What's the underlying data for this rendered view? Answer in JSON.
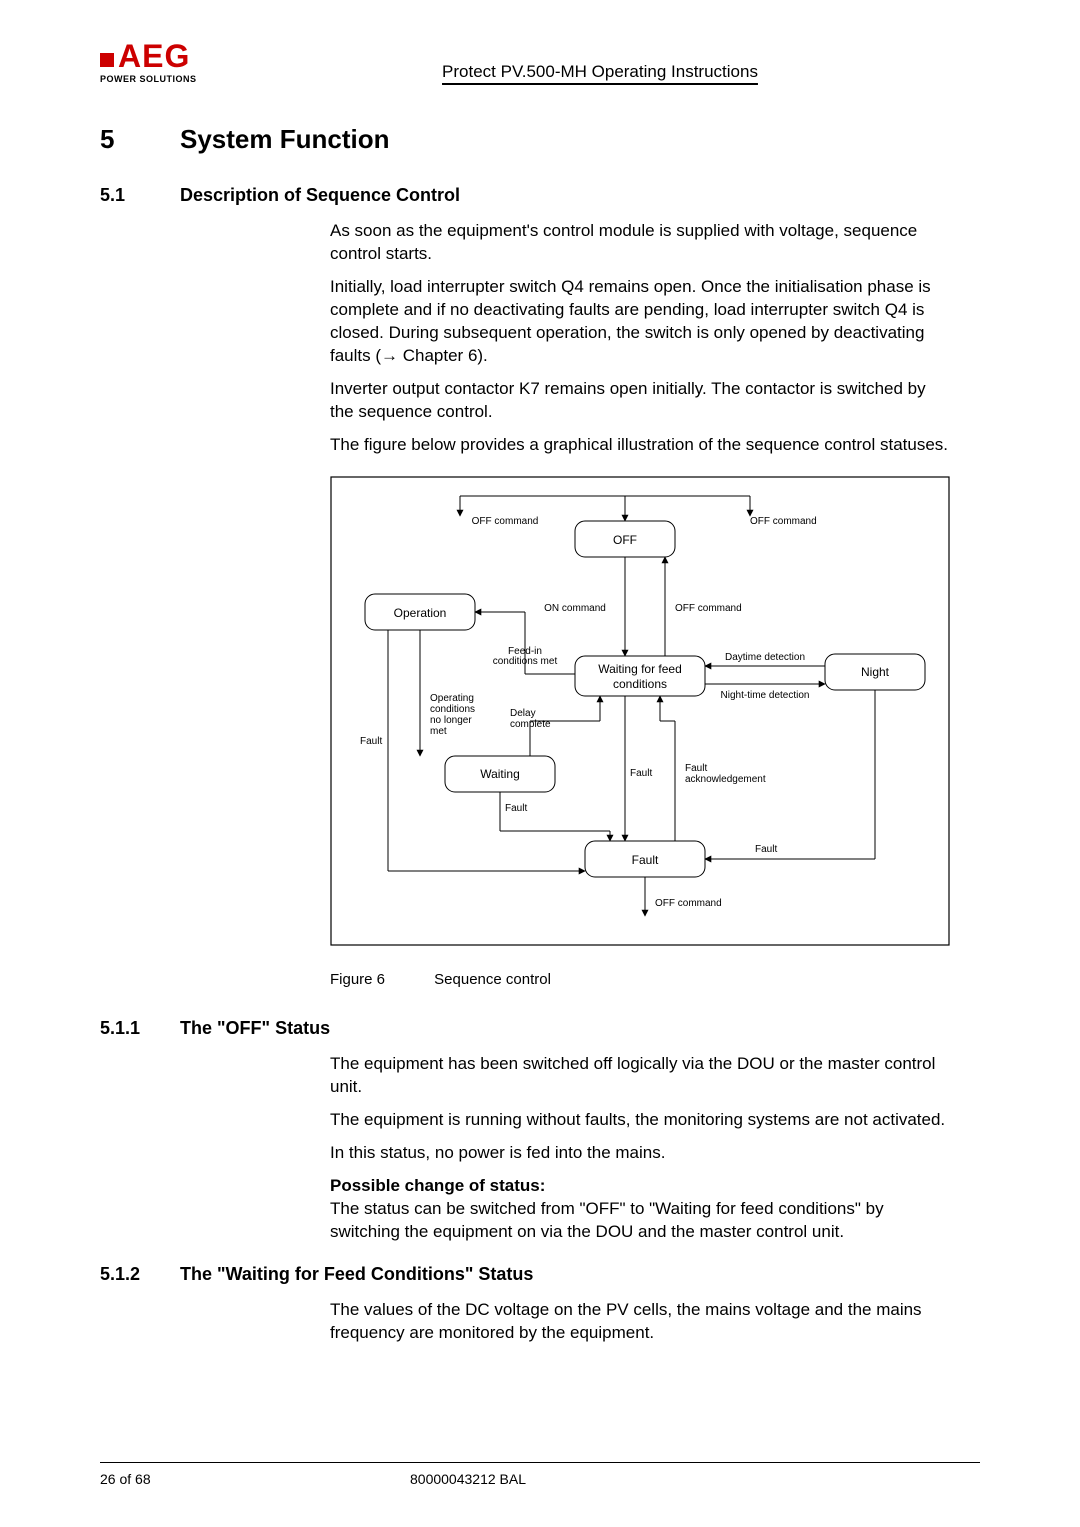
{
  "header": {
    "doc_title": "Protect PV.500-MH Operating Instructions",
    "logo_text": "AEG",
    "logo_sub": "POWER SOLUTIONS"
  },
  "section": {
    "num": "5",
    "title": "System Function"
  },
  "s51": {
    "num": "5.1",
    "title": "Description of Sequence Control",
    "p1": "As soon as the equipment's control module is supplied with voltage, sequence control starts.",
    "p2": "Initially, load interrupter switch Q4 remains open. Once the initialisation phase is complete and if no deactivating faults are pending, load interrupter switch Q4 is closed. During subsequent operation, the switch is only opened by deactivating faults (→ Chapter 6).",
    "p3": "Inverter output contactor K7 remains open initially. The contactor is switched by the sequence control.",
    "p4": "The figure below provides a graphical illustration of the sequence control statuses."
  },
  "figure": {
    "label": "Figure 6",
    "caption": "Sequence control",
    "nodes": {
      "off": "OFF",
      "operation": "Operation",
      "waiting_feed_l1": "Waiting for feed",
      "waiting_feed_l2": "conditions",
      "night": "Night",
      "waiting": "Waiting",
      "fault": "Fault"
    },
    "edges": {
      "off_cmd": "OFF command",
      "on_cmd": "ON command",
      "feed_cond_l1": "Feed-in",
      "feed_cond_l2": "conditions met",
      "daytime": "Daytime detection",
      "nighttime": "Night-time detection",
      "op_cond_l1": "Operating",
      "op_cond_l2": "conditions",
      "op_cond_l3": "no longer",
      "op_cond_l4": "met",
      "delay_l1": "Delay",
      "delay_l2": "complete",
      "fault_lbl": "Fault",
      "fault_ack_l1": "Fault",
      "fault_ack_l2": "acknowledgement"
    }
  },
  "s511": {
    "num": "5.1.1",
    "title": "The \"OFF\" Status",
    "p1": "The equipment has been switched off logically via the DOU or the master control unit.",
    "p2": "The equipment is running without faults, the monitoring systems are not activated.",
    "p3": "In this status, no power is fed into the mains.",
    "p4_strong": "Possible change of status:",
    "p4": "The status can be switched from \"OFF\" to \"Waiting for feed conditions\" by switching the equipment on via the DOU and the master control unit."
  },
  "s512": {
    "num": "5.1.2",
    "title": "The \"Waiting for Feed Conditions\" Status",
    "p1": "The values of the DC voltage on the PV cells, the mains voltage and the mains frequency are monitored by the equipment."
  },
  "footer": {
    "page": "26 of 68",
    "docnum": "80000043212 BAL"
  }
}
